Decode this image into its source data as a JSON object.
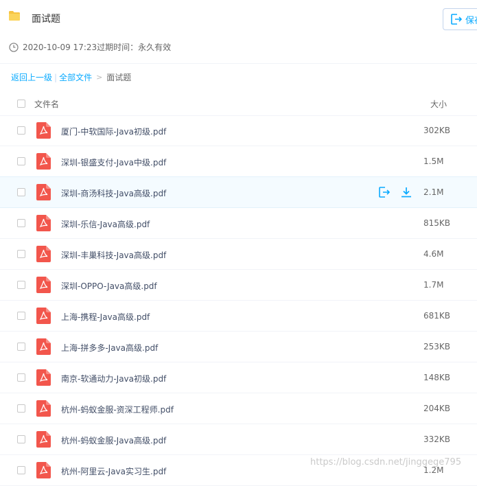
{
  "header": {
    "folder_title": "面试题",
    "save_label": "保存",
    "meta": "2020-10-09 17:23过期时间：永久有效"
  },
  "breadcrumb": {
    "back": "返回上一级",
    "sep": "|",
    "all_files": "全部文件",
    "arrow": ">",
    "current": "面试题"
  },
  "list": {
    "col_name": "文件名",
    "col_size": "大小",
    "files": [
      {
        "name": "厦门-中软国际-Java初级.pdf",
        "size": "302KB"
      },
      {
        "name": "深圳-银盛支付-Java中级.pdf",
        "size": "1.5M"
      },
      {
        "name": "深圳-商汤科技-Java高级.pdf",
        "size": "2.1M"
      },
      {
        "name": "深圳-乐信-Java高级.pdf",
        "size": "815KB"
      },
      {
        "name": "深圳-丰巢科技-Java高级.pdf",
        "size": "4.6M"
      },
      {
        "name": "深圳-OPPO-Java高级.pdf",
        "size": "1.7M"
      },
      {
        "name": "上海-携程-Java高级.pdf",
        "size": "681KB"
      },
      {
        "name": "上海-拼多多-Java高级.pdf",
        "size": "253KB"
      },
      {
        "name": "南京-软通动力-Java初级.pdf",
        "size": "148KB"
      },
      {
        "name": "杭州-蚂蚁金服-资深工程师.pdf",
        "size": "204KB"
      },
      {
        "name": "杭州-蚂蚁金服-Java高级.pdf",
        "size": "332KB"
      },
      {
        "name": "杭州-阿里云-Java实习生.pdf",
        "size": "1.2M"
      }
    ],
    "hover_index": 2
  },
  "watermark": "https://blog.csdn.net/jinggege795",
  "colors": {
    "accent": "#09aaff",
    "pdf_red": "#f2564c",
    "folder_yellow": "#f6c342"
  }
}
